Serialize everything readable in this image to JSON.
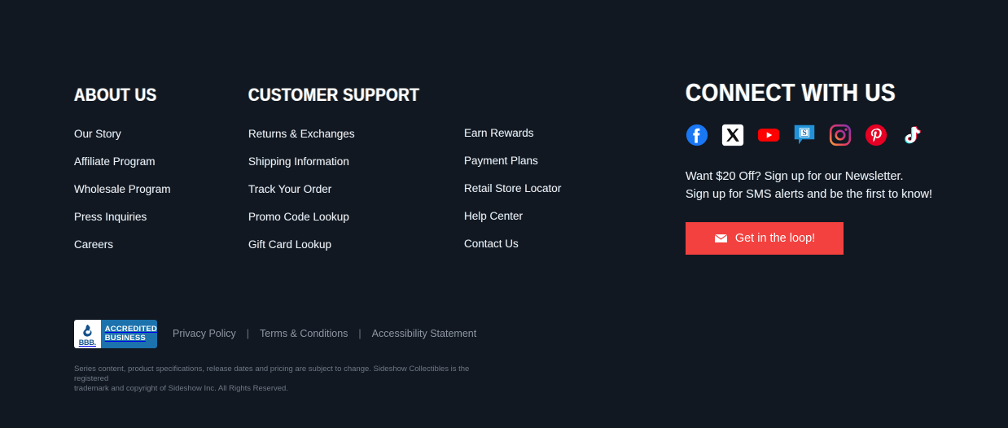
{
  "theme": {
    "background": "#111822",
    "link_color": "#e9eef3",
    "heading_color": "#ffffff",
    "accent_red": "#f2413f",
    "muted_text": "#8d96a2",
    "fineprint_color": "#6f7885"
  },
  "columns": {
    "about": {
      "heading": "ABOUT US",
      "links": [
        {
          "label": "Our Story"
        },
        {
          "label": "Affiliate Program"
        },
        {
          "label": "Wholesale Program"
        },
        {
          "label": "Press Inquiries"
        },
        {
          "label": "Careers"
        }
      ]
    },
    "support": {
      "heading": "CUSTOMER SUPPORT",
      "links_primary": [
        {
          "label": "Returns & Exchanges"
        },
        {
          "label": "Shipping Information"
        },
        {
          "label": "Track Your Order"
        },
        {
          "label": "Promo Code Lookup"
        },
        {
          "label": "Gift Card Lookup"
        }
      ],
      "links_secondary": [
        {
          "label": "Earn Rewards"
        },
        {
          "label": "Payment Plans"
        },
        {
          "label": "Retail Store Locator"
        },
        {
          "label": "Help Center"
        },
        {
          "label": "Contact Us"
        }
      ]
    }
  },
  "connect": {
    "heading": "CONNECT WITH US",
    "social": [
      {
        "name": "facebook-icon",
        "label": "Facebook",
        "color": "#1977f3"
      },
      {
        "name": "x-twitter-icon",
        "label": "X",
        "color": "#ffffff"
      },
      {
        "name": "youtube-icon",
        "label": "YouTube",
        "color": "#ff0000"
      },
      {
        "name": "sideshow-forums-icon",
        "label": "Sideshow Forums",
        "color": "#2292d8"
      },
      {
        "name": "instagram-icon",
        "label": "Instagram",
        "color": "#d6249f"
      },
      {
        "name": "pinterest-icon",
        "label": "Pinterest",
        "color": "#e60023"
      },
      {
        "name": "tiktok-icon",
        "label": "TikTok",
        "color": "#000000"
      }
    ],
    "newsletter_line_1": "Want $20 Off? Sign up for our Newsletter.",
    "newsletter_line_2": "Sign up for SMS alerts and be the first to know!",
    "cta_label": "Get in the loop!",
    "cta_icon": "envelope-icon"
  },
  "bbb": {
    "abbr": "BBB.",
    "line1": "ACCREDITED",
    "line2": "BUSINESS",
    "icon": "bbb-torch-icon"
  },
  "legal": {
    "links": [
      {
        "label": "Privacy Policy"
      },
      {
        "label": "Terms & Conditions"
      },
      {
        "label": "Accessibility Statement"
      }
    ],
    "separator": "|"
  },
  "fineprint": {
    "line1": "Series content, product specifications, release dates and pricing are subject to change. Sideshow Collectibles is the registered",
    "line2": "trademark and copyright of Sideshow Inc. All Rights Reserved."
  }
}
